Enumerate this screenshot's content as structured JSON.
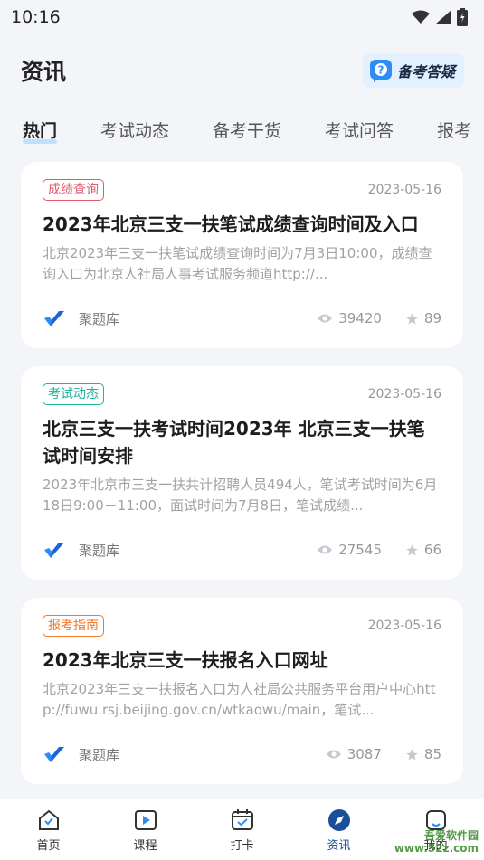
{
  "status_bar": {
    "time": "10:16"
  },
  "header": {
    "title": "资讯",
    "qa_button_label": "备考答疑"
  },
  "tabs": [
    {
      "label": "热门",
      "active": true
    },
    {
      "label": "考试动态",
      "active": false
    },
    {
      "label": "备考干货",
      "active": false
    },
    {
      "label": "考试问答",
      "active": false
    },
    {
      "label": "报考",
      "active": false
    }
  ],
  "articles": [
    {
      "tag": "成绩查询",
      "tag_color": "#e05a6a",
      "date": "2023-05-16",
      "title": "2023年北京三支一扶笔试成绩查询时间及入口",
      "summary": "北京2023年三支一扶笔试成绩查询时间为7月3日10:00，成绩查询入口为北京人社局人事考试服务频道http://...",
      "source": "聚题库",
      "views": "39420",
      "stars": "89"
    },
    {
      "tag": "考试动态",
      "tag_color": "#1fb59a",
      "date": "2023-05-16",
      "title": "北京三支一扶考试时间2023年 北京三支一扶笔试时间安排",
      "summary": "2023年北京市三支一扶共计招聘人员494人，笔试考试时间为6月18日9:00－11:00，面试时间为7月8日，笔试成绩...",
      "source": "聚题库",
      "views": "27545",
      "stars": "66"
    },
    {
      "tag": "报考指南",
      "tag_color": "#f07a2a",
      "date": "2023-05-16",
      "title": "2023年北京三支一扶报名入口网址",
      "summary": "北京2023年三支一扶报名入口为人社局公共服务平台用户中心http://fuwu.rsj.beijing.gov.cn/wtkaowu/main，笔试...",
      "source": "聚题库",
      "views": "3087",
      "stars": "85"
    }
  ],
  "bottom_nav": [
    {
      "label": "首页",
      "icon": "home-icon",
      "active": false
    },
    {
      "label": "课程",
      "icon": "play-icon",
      "active": false
    },
    {
      "label": "打卡",
      "icon": "calendar-check-icon",
      "active": false
    },
    {
      "label": "资讯",
      "icon": "compass-icon",
      "active": true
    },
    {
      "label": "我的",
      "icon": "user-icon",
      "active": false
    }
  ],
  "watermark": {
    "line1": "吾爱软件园",
    "line2": "www.52z.com"
  },
  "colors": {
    "accent": "#1a4f9c",
    "background": "#f3f5f9"
  }
}
